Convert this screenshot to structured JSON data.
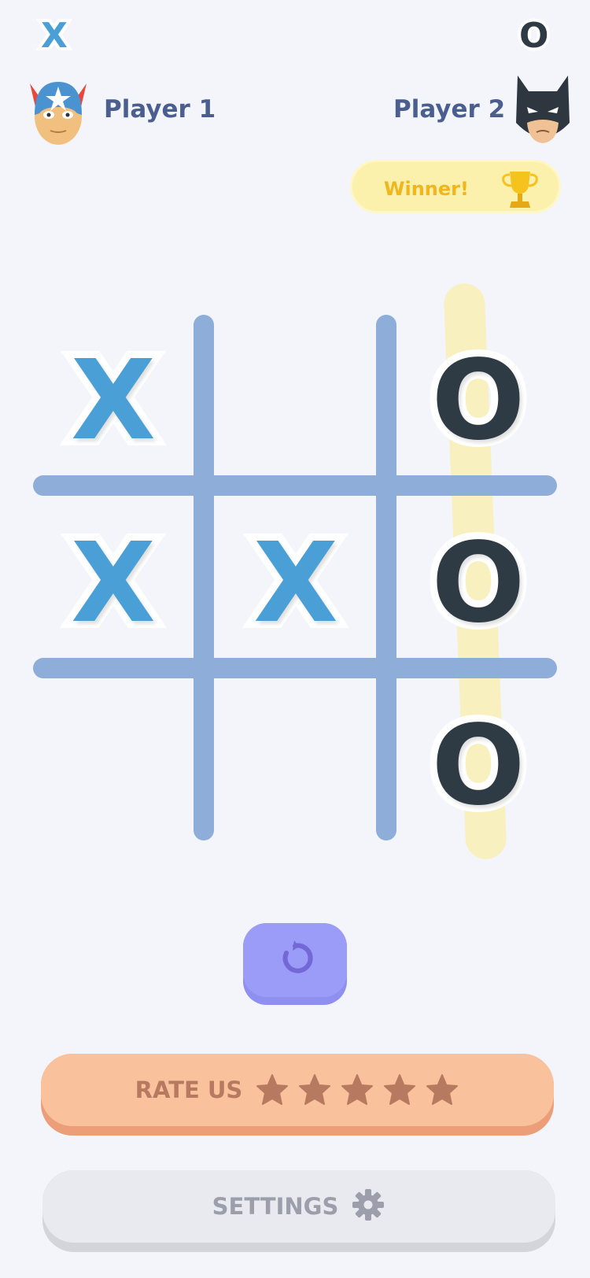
{
  "header": {
    "player1_marker": "X",
    "player2_marker": "O",
    "player1_name": "Player 1",
    "player2_name": "Player 2",
    "player1_avatar": "captain-hero-icon",
    "player2_avatar": "bat-hero-icon"
  },
  "winner_badge": {
    "label": "Winner!",
    "icon": "trophy-icon"
  },
  "board": {
    "cells": [
      [
        "X",
        "",
        "O"
      ],
      [
        "X",
        "X",
        "O"
      ],
      [
        "",
        "",
        "O"
      ]
    ],
    "winning_line": "right-column"
  },
  "controls": {
    "restart_icon": "restart-icon",
    "rate_label": "RATE US",
    "rate_stars": 5,
    "settings_label": "SETTINGS",
    "settings_icon": "gear-icon"
  },
  "colors": {
    "x_color": "#4aa0d6",
    "o_color": "#2f3b44",
    "grid": "#8eaed9",
    "highlight": "#fcec96",
    "restart": "#9a9cf8",
    "rate": "#f9c29c",
    "settings": "#e9eaef"
  }
}
